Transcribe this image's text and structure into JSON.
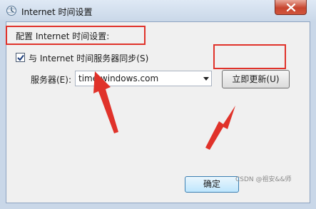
{
  "window": {
    "title": "Internet 时间设置",
    "icon": "clock-globe-icon",
    "close_icon": "close-icon"
  },
  "settings": {
    "heading": "配置 Internet 时间设置:",
    "sync_checkbox": {
      "checked": true,
      "label": "与 Internet 时间服务器同步(S)"
    },
    "server": {
      "label": "服务器(E):",
      "value": "time.windows.com"
    },
    "update_now_label": "立即更新(U)",
    "ok_label": "确定"
  },
  "annotations": {
    "highlight_color": "#e0322a"
  },
  "watermark": "CSDN @祖安&&师"
}
